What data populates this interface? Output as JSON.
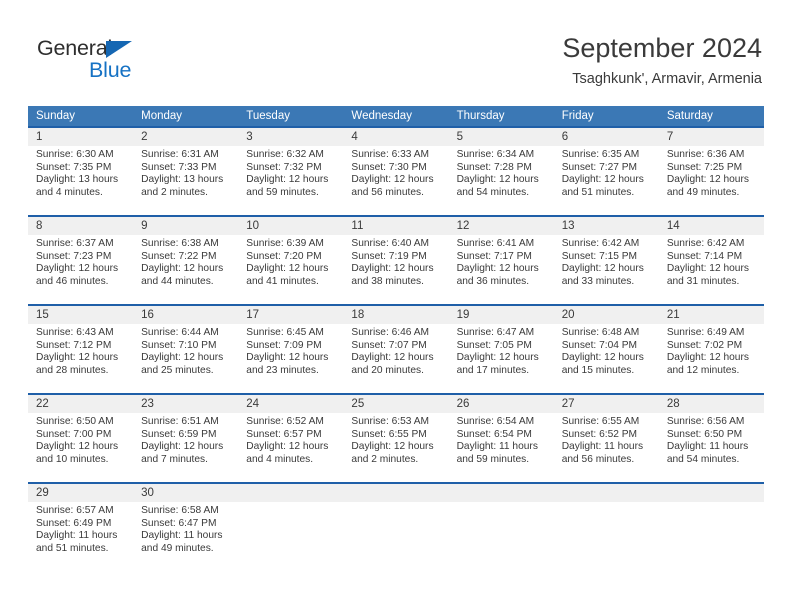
{
  "brand": {
    "name_top": "General",
    "name_bottom": "Blue",
    "accent_color": "#1672c4",
    "triangle_color": "#1567b3"
  },
  "header": {
    "title": "September 2024",
    "subtitle": "Tsaghkunk', Armavir, Armenia"
  },
  "theme": {
    "header_blue": "#3b78b5",
    "separator_blue": "#1f5fa8",
    "date_band_gray": "#f0f0f0",
    "text_color": "#3a3a3a"
  },
  "calendar": {
    "weekday_headers": [
      "Sunday",
      "Monday",
      "Tuesday",
      "Wednesday",
      "Thursday",
      "Friday",
      "Saturday"
    ],
    "weeks": [
      [
        {
          "date": "1",
          "sunrise": "Sunrise: 6:30 AM",
          "sunset": "Sunset: 7:35 PM",
          "daylight1": "Daylight: 13 hours",
          "daylight2": "and 4 minutes."
        },
        {
          "date": "2",
          "sunrise": "Sunrise: 6:31 AM",
          "sunset": "Sunset: 7:33 PM",
          "daylight1": "Daylight: 13 hours",
          "daylight2": "and 2 minutes."
        },
        {
          "date": "3",
          "sunrise": "Sunrise: 6:32 AM",
          "sunset": "Sunset: 7:32 PM",
          "daylight1": "Daylight: 12 hours",
          "daylight2": "and 59 minutes."
        },
        {
          "date": "4",
          "sunrise": "Sunrise: 6:33 AM",
          "sunset": "Sunset: 7:30 PM",
          "daylight1": "Daylight: 12 hours",
          "daylight2": "and 56 minutes."
        },
        {
          "date": "5",
          "sunrise": "Sunrise: 6:34 AM",
          "sunset": "Sunset: 7:28 PM",
          "daylight1": "Daylight: 12 hours",
          "daylight2": "and 54 minutes."
        },
        {
          "date": "6",
          "sunrise": "Sunrise: 6:35 AM",
          "sunset": "Sunset: 7:27 PM",
          "daylight1": "Daylight: 12 hours",
          "daylight2": "and 51 minutes."
        },
        {
          "date": "7",
          "sunrise": "Sunrise: 6:36 AM",
          "sunset": "Sunset: 7:25 PM",
          "daylight1": "Daylight: 12 hours",
          "daylight2": "and 49 minutes."
        }
      ],
      [
        {
          "date": "8",
          "sunrise": "Sunrise: 6:37 AM",
          "sunset": "Sunset: 7:23 PM",
          "daylight1": "Daylight: 12 hours",
          "daylight2": "and 46 minutes."
        },
        {
          "date": "9",
          "sunrise": "Sunrise: 6:38 AM",
          "sunset": "Sunset: 7:22 PM",
          "daylight1": "Daylight: 12 hours",
          "daylight2": "and 44 minutes."
        },
        {
          "date": "10",
          "sunrise": "Sunrise: 6:39 AM",
          "sunset": "Sunset: 7:20 PM",
          "daylight1": "Daylight: 12 hours",
          "daylight2": "and 41 minutes."
        },
        {
          "date": "11",
          "sunrise": "Sunrise: 6:40 AM",
          "sunset": "Sunset: 7:19 PM",
          "daylight1": "Daylight: 12 hours",
          "daylight2": "and 38 minutes."
        },
        {
          "date": "12",
          "sunrise": "Sunrise: 6:41 AM",
          "sunset": "Sunset: 7:17 PM",
          "daylight1": "Daylight: 12 hours",
          "daylight2": "and 36 minutes."
        },
        {
          "date": "13",
          "sunrise": "Sunrise: 6:42 AM",
          "sunset": "Sunset: 7:15 PM",
          "daylight1": "Daylight: 12 hours",
          "daylight2": "and 33 minutes."
        },
        {
          "date": "14",
          "sunrise": "Sunrise: 6:42 AM",
          "sunset": "Sunset: 7:14 PM",
          "daylight1": "Daylight: 12 hours",
          "daylight2": "and 31 minutes."
        }
      ],
      [
        {
          "date": "15",
          "sunrise": "Sunrise: 6:43 AM",
          "sunset": "Sunset: 7:12 PM",
          "daylight1": "Daylight: 12 hours",
          "daylight2": "and 28 minutes."
        },
        {
          "date": "16",
          "sunrise": "Sunrise: 6:44 AM",
          "sunset": "Sunset: 7:10 PM",
          "daylight1": "Daylight: 12 hours",
          "daylight2": "and 25 minutes."
        },
        {
          "date": "17",
          "sunrise": "Sunrise: 6:45 AM",
          "sunset": "Sunset: 7:09 PM",
          "daylight1": "Daylight: 12 hours",
          "daylight2": "and 23 minutes."
        },
        {
          "date": "18",
          "sunrise": "Sunrise: 6:46 AM",
          "sunset": "Sunset: 7:07 PM",
          "daylight1": "Daylight: 12 hours",
          "daylight2": "and 20 minutes."
        },
        {
          "date": "19",
          "sunrise": "Sunrise: 6:47 AM",
          "sunset": "Sunset: 7:05 PM",
          "daylight1": "Daylight: 12 hours",
          "daylight2": "and 17 minutes."
        },
        {
          "date": "20",
          "sunrise": "Sunrise: 6:48 AM",
          "sunset": "Sunset: 7:04 PM",
          "daylight1": "Daylight: 12 hours",
          "daylight2": "and 15 minutes."
        },
        {
          "date": "21",
          "sunrise": "Sunrise: 6:49 AM",
          "sunset": "Sunset: 7:02 PM",
          "daylight1": "Daylight: 12 hours",
          "daylight2": "and 12 minutes."
        }
      ],
      [
        {
          "date": "22",
          "sunrise": "Sunrise: 6:50 AM",
          "sunset": "Sunset: 7:00 PM",
          "daylight1": "Daylight: 12 hours",
          "daylight2": "and 10 minutes."
        },
        {
          "date": "23",
          "sunrise": "Sunrise: 6:51 AM",
          "sunset": "Sunset: 6:59 PM",
          "daylight1": "Daylight: 12 hours",
          "daylight2": "and 7 minutes."
        },
        {
          "date": "24",
          "sunrise": "Sunrise: 6:52 AM",
          "sunset": "Sunset: 6:57 PM",
          "daylight1": "Daylight: 12 hours",
          "daylight2": "and 4 minutes."
        },
        {
          "date": "25",
          "sunrise": "Sunrise: 6:53 AM",
          "sunset": "Sunset: 6:55 PM",
          "daylight1": "Daylight: 12 hours",
          "daylight2": "and 2 minutes."
        },
        {
          "date": "26",
          "sunrise": "Sunrise: 6:54 AM",
          "sunset": "Sunset: 6:54 PM",
          "daylight1": "Daylight: 11 hours",
          "daylight2": "and 59 minutes."
        },
        {
          "date": "27",
          "sunrise": "Sunrise: 6:55 AM",
          "sunset": "Sunset: 6:52 PM",
          "daylight1": "Daylight: 11 hours",
          "daylight2": "and 56 minutes."
        },
        {
          "date": "28",
          "sunrise": "Sunrise: 6:56 AM",
          "sunset": "Sunset: 6:50 PM",
          "daylight1": "Daylight: 11 hours",
          "daylight2": "and 54 minutes."
        }
      ],
      [
        {
          "date": "29",
          "sunrise": "Sunrise: 6:57 AM",
          "sunset": "Sunset: 6:49 PM",
          "daylight1": "Daylight: 11 hours",
          "daylight2": "and 51 minutes."
        },
        {
          "date": "30",
          "sunrise": "Sunrise: 6:58 AM",
          "sunset": "Sunset: 6:47 PM",
          "daylight1": "Daylight: 11 hours",
          "daylight2": "and 49 minutes."
        },
        {
          "date": "",
          "sunrise": "",
          "sunset": "",
          "daylight1": "",
          "daylight2": ""
        },
        {
          "date": "",
          "sunrise": "",
          "sunset": "",
          "daylight1": "",
          "daylight2": ""
        },
        {
          "date": "",
          "sunrise": "",
          "sunset": "",
          "daylight1": "",
          "daylight2": ""
        },
        {
          "date": "",
          "sunrise": "",
          "sunset": "",
          "daylight1": "",
          "daylight2": ""
        },
        {
          "date": "",
          "sunrise": "",
          "sunset": "",
          "daylight1": "",
          "daylight2": ""
        }
      ]
    ]
  }
}
